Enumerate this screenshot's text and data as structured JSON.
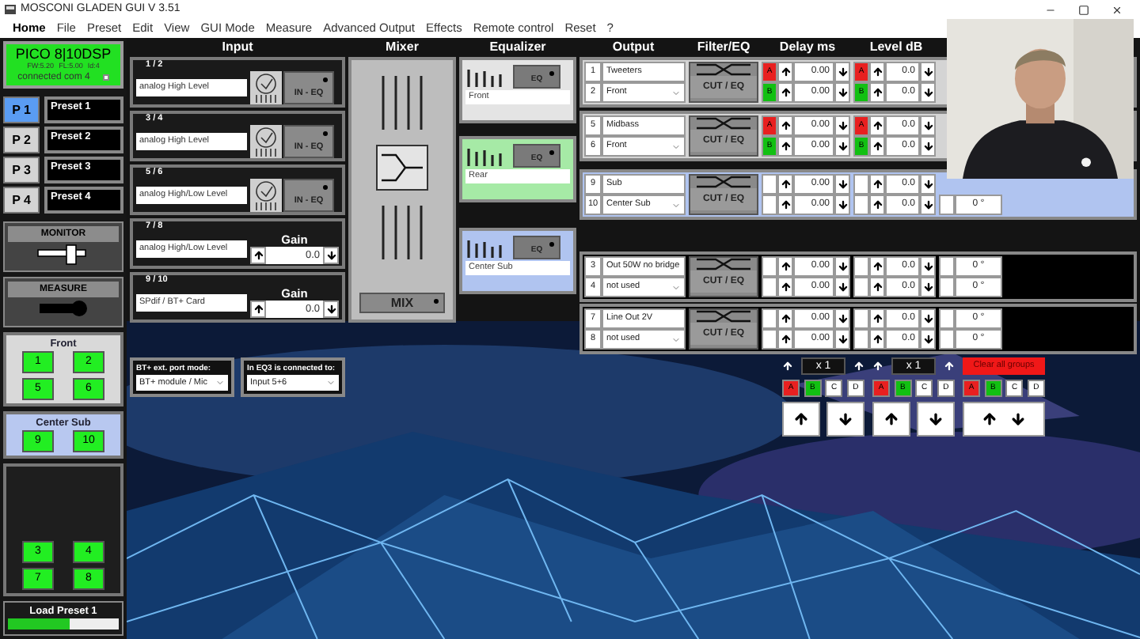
{
  "window": {
    "title": "MOSCONI GLADEN GUI V 3.51"
  },
  "menu": [
    {
      "label": "Home",
      "selected": true
    },
    {
      "label": "File",
      "selected": false
    },
    {
      "label": "Preset",
      "selected": false
    },
    {
      "label": "Edit",
      "selected": false
    },
    {
      "label": "View",
      "selected": false
    },
    {
      "label": "GUI Mode",
      "selected": false
    },
    {
      "label": "Measure",
      "selected": false
    },
    {
      "label": "Advanced Output",
      "selected": false
    },
    {
      "label": "Effects",
      "selected": false
    },
    {
      "label": "Remote control",
      "selected": false
    },
    {
      "label": "Reset",
      "selected": false
    },
    {
      "label": "?",
      "selected": false
    }
  ],
  "device": {
    "name": "PICO 8|10DSP",
    "fw": "FW:5.20",
    "fl": "FL:5.00",
    "id": "Id:4",
    "status": "connected com 4"
  },
  "presets": [
    {
      "key": "P 1",
      "name": "Preset 1",
      "selected": true
    },
    {
      "key": "P 2",
      "name": "Preset 2",
      "selected": false
    },
    {
      "key": "P 3",
      "name": "Preset 3",
      "selected": false
    },
    {
      "key": "P 4",
      "name": "Preset 4",
      "selected": false
    }
  ],
  "monitor": {
    "label": "MONITOR"
  },
  "measure": {
    "label": "MEASURE"
  },
  "channel_groups": [
    {
      "title": "Front",
      "color": "#d9d9d9",
      "channels": [
        "1",
        "2",
        "5",
        "6"
      ]
    },
    {
      "title": "Center Sub",
      "color": "#b8c8f0",
      "channels": [
        "9",
        "10"
      ]
    },
    {
      "color": "#1e1e1e",
      "channels": [
        "3",
        "4",
        "7",
        "8"
      ]
    }
  ],
  "load": {
    "label": "Load Preset 1",
    "level": 0.55
  },
  "input": {
    "heading": "Input",
    "rows": [
      {
        "kind": "eq",
        "pair": "1 / 2",
        "source": "analog High Level",
        "badge": "IN - EQ"
      },
      {
        "kind": "eq",
        "pair": "3 / 4",
        "source": "analog High Level",
        "badge": "IN - EQ"
      },
      {
        "kind": "eq",
        "pair": "5 / 6",
        "source": "analog High/Low Level",
        "badge": "IN - EQ"
      },
      {
        "kind": "gain",
        "pair": "7 / 8",
        "source": "analog High/Low Level",
        "gain_label": "Gain",
        "gain": "0.0"
      },
      {
        "kind": "gain",
        "pair": "9 / 10",
        "source": "SPdif / BT+ Card",
        "gain_label": "Gain",
        "gain": "0.0"
      }
    ]
  },
  "mixer": {
    "heading": "Mixer",
    "button": "MIX"
  },
  "equalizer": {
    "heading": "Equalizer",
    "items": [
      {
        "label": "Front",
        "badge": "EQ",
        "color": "#e4e4e4"
      },
      {
        "label": "Rear",
        "badge": "EQ",
        "color": "#a6eaa6"
      },
      {
        "label": "Center Sub",
        "badge": "EQ",
        "color": "#b0c4f0"
      }
    ]
  },
  "output": {
    "headers": [
      "Output",
      "Filter/EQ",
      "Delay ms",
      "Level dB"
    ],
    "groups": [
      {
        "color": "#d4d4d4",
        "filter": "CUT / EQ",
        "rows": [
          {
            "kind": "text",
            "number": "1",
            "name": "Tweeters",
            "delay_tag": {
              "label": "A",
              "color": "#e82020"
            },
            "delay": "0.00",
            "level_tag": {
              "label": "A",
              "color": "#e82020"
            },
            "level": "0.0"
          },
          {
            "kind": "select",
            "number": "2",
            "name": "Front",
            "delay_tag": {
              "label": "B",
              "color": "#12c012"
            },
            "delay": "0.00",
            "level_tag": {
              "label": "B",
              "color": "#12c012"
            },
            "level": "0.0"
          }
        ]
      },
      {
        "color": "#d4d4d4",
        "filter": "CUT / EQ",
        "rows": [
          {
            "kind": "text",
            "number": "5",
            "name": "Midbass",
            "delay_tag": {
              "label": "A",
              "color": "#e82020"
            },
            "delay": "0.00",
            "level_tag": {
              "label": "A",
              "color": "#e82020"
            },
            "level": "0.0"
          },
          {
            "kind": "select",
            "number": "6",
            "name": "Front",
            "delay_tag": {
              "label": "B",
              "color": "#12c012"
            },
            "delay": "0.00",
            "level_tag": {
              "label": "B",
              "color": "#12c012"
            },
            "level": "0.0"
          }
        ]
      },
      {
        "color": "#b0c4f0",
        "filter": "CUT / EQ",
        "rows": [
          {
            "kind": "text",
            "number": "9",
            "name": "Sub",
            "delay": "0.00",
            "level": "0.0"
          },
          {
            "kind": "select",
            "number": "10",
            "name": "Center Sub",
            "delay": "0.00",
            "level": "0.0",
            "phase": "0 °"
          }
        ]
      },
      {
        "color": "#000000",
        "filter": "CUT / EQ",
        "rows": [
          {
            "kind": "text",
            "number": "3",
            "name": "Out 50W no bridge",
            "delay": "0.00",
            "level": "0.0",
            "phase": "0 °"
          },
          {
            "kind": "select",
            "number": "4",
            "name": "not used",
            "delay": "0.00",
            "level": "0.0",
            "phase": "0 °"
          }
        ]
      },
      {
        "color": "#000000",
        "filter": "CUT / EQ",
        "rows": [
          {
            "kind": "text",
            "number": "7",
            "name": "Line Out 2V",
            "delay": "0.00",
            "level": "0.0",
            "phase": "0 °"
          },
          {
            "kind": "select",
            "number": "8",
            "name": "not used",
            "delay": "0.00",
            "level": "0.0",
            "phase": "0 °"
          }
        ]
      }
    ]
  },
  "ports": [
    {
      "label": "BT+ ext. port mode:",
      "value": "BT+ module / Mic"
    },
    {
      "label": "In EQ3 is connected to:",
      "value": "Input 5+6"
    }
  ],
  "group_controls": [
    {
      "kind": "multiplier",
      "value": "x 1",
      "letters": [
        {
          "label": "A",
          "color": "#e82020"
        },
        {
          "label": "B",
          "color": "#12c012"
        },
        {
          "label": "C",
          "color": "#ffffff"
        },
        {
          "label": "D",
          "color": "#ffffff"
        }
      ]
    },
    {
      "kind": "multiplier",
      "value": "x 1",
      "letters": [
        {
          "label": "A",
          "color": "#e82020"
        },
        {
          "label": "B",
          "color": "#12c012"
        },
        {
          "label": "C",
          "color": "#ffffff"
        },
        {
          "label": "D",
          "color": "#ffffff"
        }
      ]
    },
    {
      "kind": "clear",
      "button": "Clear all groups",
      "letters": [
        {
          "label": "A",
          "color": "#e82020"
        },
        {
          "label": "B",
          "color": "#12c012"
        },
        {
          "label": "C",
          "color": "#ffffff"
        },
        {
          "label": "D",
          "color": "#ffffff"
        }
      ]
    }
  ]
}
